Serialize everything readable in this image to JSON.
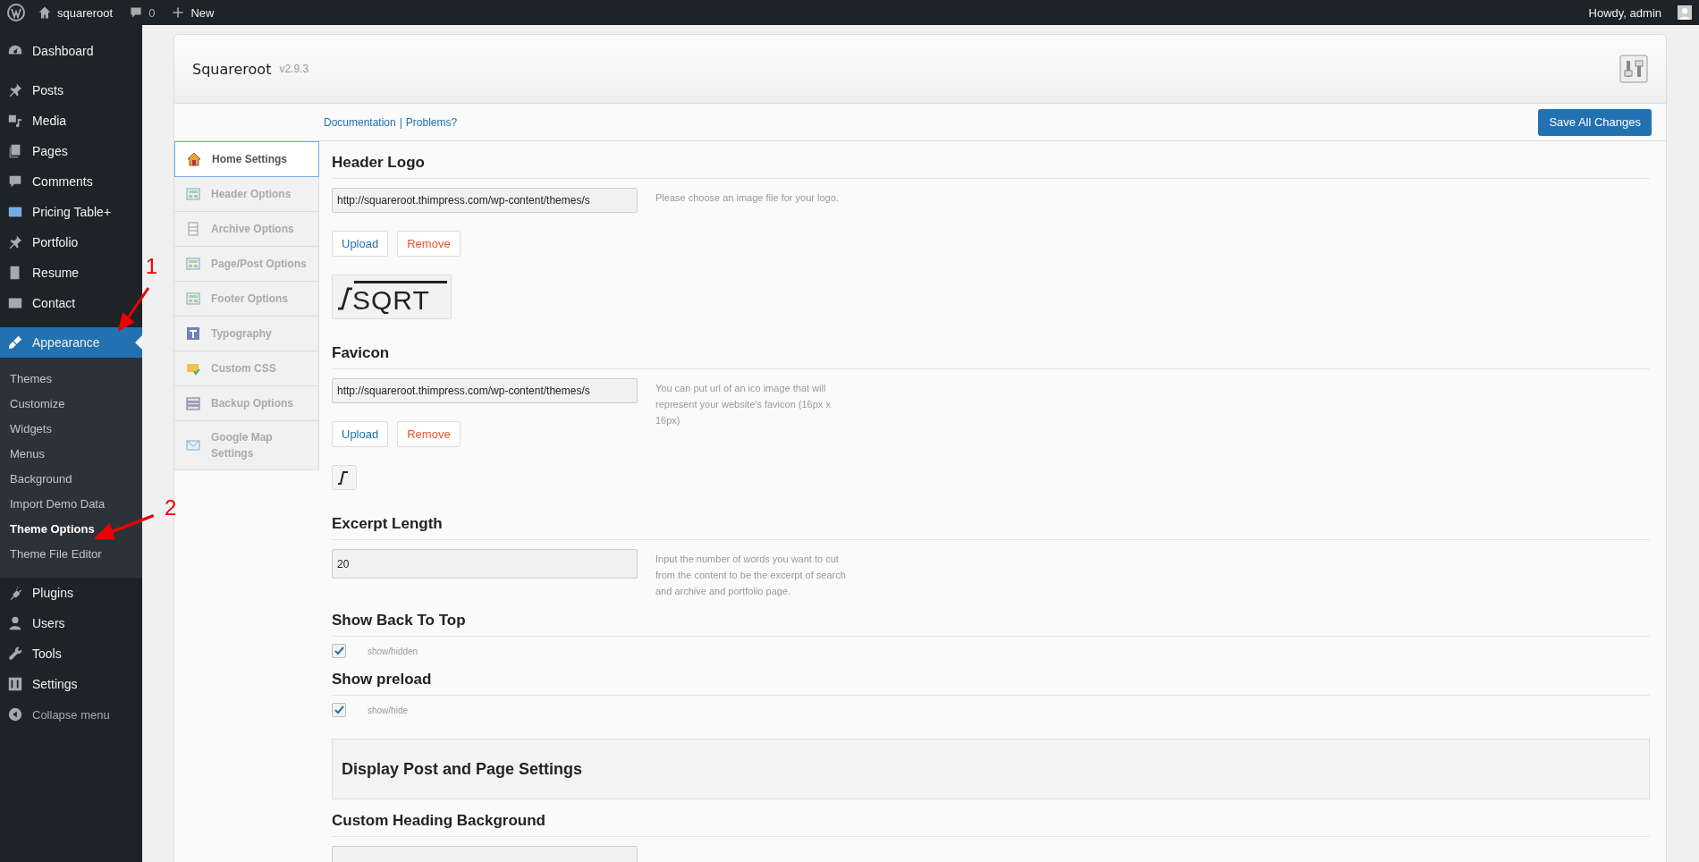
{
  "admin_bar": {
    "site": "squareroot",
    "comments": "0",
    "new": "New",
    "greeting": "Howdy, admin"
  },
  "sidebar": {
    "items": [
      {
        "label": "Dashboard",
        "selected": false
      },
      {
        "label": "Posts",
        "selected": false
      },
      {
        "label": "Media",
        "selected": false
      },
      {
        "label": "Pages",
        "selected": false
      },
      {
        "label": "Comments",
        "selected": false
      },
      {
        "label": "Pricing Table+",
        "selected": false
      },
      {
        "label": "Portfolio",
        "selected": false
      },
      {
        "label": "Resume",
        "selected": false
      },
      {
        "label": "Contact",
        "selected": false
      },
      {
        "label": "Appearance",
        "selected": true,
        "children": [
          {
            "label": "Themes",
            "selected": false
          },
          {
            "label": "Customize",
            "selected": false
          },
          {
            "label": "Widgets",
            "selected": false
          },
          {
            "label": "Menus",
            "selected": false
          },
          {
            "label": "Background",
            "selected": false
          },
          {
            "label": "Import Demo Data",
            "selected": false
          },
          {
            "label": "Theme Options",
            "selected": true
          },
          {
            "label": "Theme File Editor",
            "selected": false
          }
        ]
      },
      {
        "label": "Plugins",
        "selected": false
      },
      {
        "label": "Users",
        "selected": false
      },
      {
        "label": "Tools",
        "selected": false
      },
      {
        "label": "Settings",
        "selected": false
      }
    ],
    "collapse": "Collapse menu"
  },
  "annotations": [
    {
      "label": "1"
    },
    {
      "label": "2"
    }
  ],
  "panel": {
    "title": "Squareroot",
    "version": "v2.9.3",
    "links": [
      {
        "label": "Documentation"
      },
      {
        "label": "Problems?"
      }
    ],
    "separator": "|",
    "save": "Save All Changes",
    "nav": [
      {
        "label": "Home Settings",
        "selected": true
      },
      {
        "label": "Header Options",
        "selected": false
      },
      {
        "label": "Archive Options",
        "selected": false
      },
      {
        "label": "Page/Post Options",
        "selected": false
      },
      {
        "label": "Footer Options",
        "selected": false
      },
      {
        "label": "Typography",
        "selected": false
      },
      {
        "label": "Custom CSS",
        "selected": false
      },
      {
        "label": "Backup Options",
        "selected": false
      },
      {
        "label": "Google Map Settings",
        "selected": false
      }
    ],
    "sections": [
      {
        "kind": "upload",
        "title": "Header Logo",
        "value": "http://squareroot.thimpress.com/wp-content/themes/s",
        "note": "Please choose an image file for your logo.",
        "upload": "Upload",
        "remove": "Remove",
        "preview_text": "SQRT"
      },
      {
        "kind": "upload",
        "title": "Favicon",
        "value": "http://squareroot.thimpress.com/wp-content/themes/s",
        "note": "You can put url of an ico image that will represent your website's favicon (16px x 16px)",
        "upload": "Upload",
        "remove": "Remove"
      },
      {
        "kind": "text",
        "title": "Excerpt Length",
        "value": "20",
        "note": "Input the number of words you want to cut from the content to be the excerpt of search and archive and portfolio page."
      },
      {
        "kind": "checkbox",
        "title": "Show Back To Top",
        "checked": true,
        "label": "show/hidden"
      },
      {
        "kind": "checkbox",
        "title": "Show preload",
        "checked": true,
        "label": "show/hide"
      },
      {
        "kind": "group",
        "title": "Display Post and Page Settings"
      },
      {
        "kind": "text",
        "title": "Custom Heading Background"
      }
    ]
  }
}
